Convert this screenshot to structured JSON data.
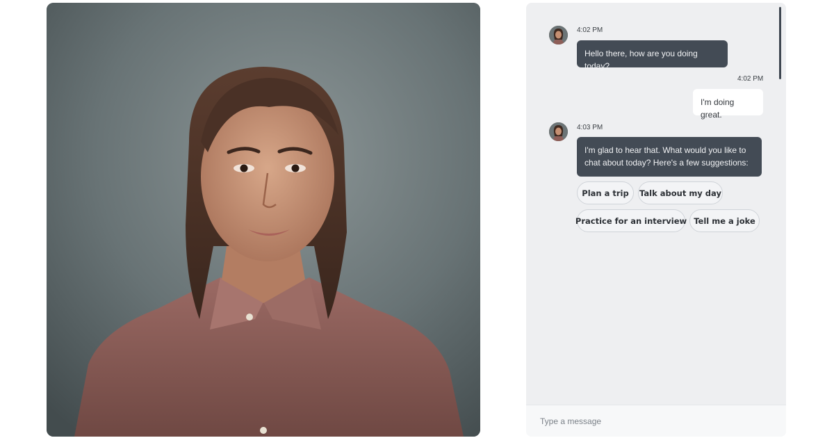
{
  "video": {
    "subject": "digital-human-avatar"
  },
  "chat": {
    "messages": [
      {
        "sender": "bot",
        "time": "4:02 PM",
        "text": "Hello there, how are you doing today?"
      },
      {
        "sender": "user",
        "time": "4:02 PM",
        "text": "I'm doing great."
      },
      {
        "sender": "bot",
        "time": "4:03 PM",
        "line1": "I'm glad to hear that. What would you like to",
        "line2": "chat about today? Here's a few suggestions:"
      }
    ],
    "suggestions": [
      "Plan a trip",
      "Talk about my day",
      "Practice for an interview",
      "Tell me a joke"
    ],
    "composer": {
      "placeholder": "Type a message"
    }
  },
  "colors": {
    "bot_bubble": "#434b55",
    "user_bubble": "#ffffff",
    "chat_background": "#eeeff1"
  }
}
